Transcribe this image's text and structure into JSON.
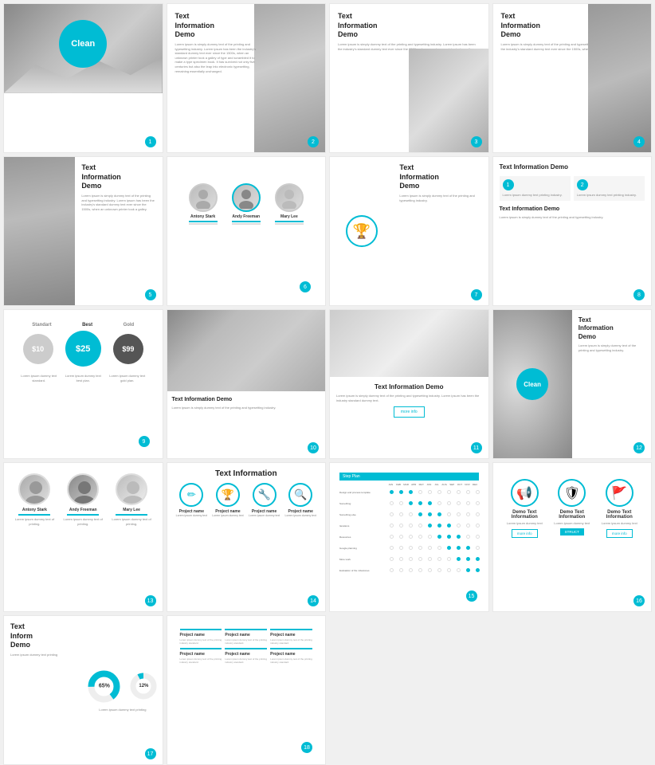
{
  "slides": [
    {
      "id": 1,
      "type": "clean-hero",
      "badge": "Clean",
      "step": "1"
    },
    {
      "id": 2,
      "type": "text-image-right",
      "title": "Text\nInformation\nDemo",
      "body": "Lorem ipsum is simply dummy text of the printing and typesetting industry. Lorem ipsum has been the industry's standard dummy text ever since the 1500s, when an unknown printer took a galley of type and scrambled it to make a type specimen book. It has survived not only five centuries but also the leap into electronic typesetting, remaining essentially unchanged.",
      "step": "2"
    },
    {
      "id": 3,
      "type": "text-image-right",
      "title": "Text\nInformation\nDemo",
      "body": "Lorem ipsum is simply dummy text of the printing and typesetting industry. Lorem ipsum has been the industry's standard dummy text ever since the 1500s, when an unknown printer took a galley.",
      "step": "3"
    },
    {
      "id": 4,
      "type": "team",
      "members": [
        {
          "name": "Antony Stark"
        },
        {
          "name": "Andy Freeman"
        },
        {
          "name": "Mary Lee"
        }
      ],
      "step": "4"
    },
    {
      "id": 5,
      "type": "trophy-text",
      "title": "Text\nInformation\nDemo",
      "body": "Lorem ipsum is simply dummy text of the printing and typesetting industry.",
      "step": "5"
    },
    {
      "id": 6,
      "type": "text-image-split",
      "title": "Text Information Demo",
      "body": "Lorem ipsum is simply dummy text of the printing and typesetting industry. Lorem ipsum has been the industry standard.",
      "step": "6"
    },
    {
      "id": 7,
      "type": "text-image-split2",
      "title": "Text Information Demo",
      "subtitle": "Text Information Demo",
      "body": "Lorem ipsum is simply dummy text of the printing and typesetting industry.",
      "step": "7"
    },
    {
      "id": 8,
      "type": "pricing",
      "plans": [
        {
          "name": "Standart",
          "price": "$10",
          "style": "standard"
        },
        {
          "name": "Best",
          "price": "$25",
          "style": "best"
        },
        {
          "name": "Gold",
          "price": "$99",
          "style": "gold"
        }
      ],
      "step": "8"
    },
    {
      "id": 9,
      "type": "wave-text",
      "title": "Text Information Demo",
      "body": "Lorem ipsum is simply dummy text of the printing and typesetting industry.",
      "step": "9"
    },
    {
      "id": 10,
      "type": "center-text",
      "title": "Text Information Demo",
      "body": "Lorem ipsum is simply dummy text of the printing and typesetting industry. Lorem ipsum has been the industry standard dummy text.",
      "btn": "more info",
      "step": "10"
    },
    {
      "id": 11,
      "type": "circle-clean-scenic",
      "title": "Text\nInformation\nDemo",
      "badge": "Clean",
      "body": "Lorem ipsum is simply dummy text of the printing and typesetting industry.",
      "step": "11"
    },
    {
      "id": 12,
      "type": "team2",
      "title": "Text Information",
      "members": [
        {
          "name": "Antony Stark"
        },
        {
          "name": "Andy Freeman"
        },
        {
          "name": "Mary Lee"
        }
      ],
      "step": "12"
    },
    {
      "id": 13,
      "type": "icons-4",
      "title": "Text Information",
      "items": [
        {
          "label": "Project name",
          "desc": "Lorem ipsum dummy text"
        },
        {
          "label": "Project name",
          "desc": "Lorem ipsum dummy text"
        },
        {
          "label": "Project name",
          "desc": "Lorem ipsum dummy text"
        },
        {
          "label": "Project name",
          "desc": "Lorem ipsum dummy text"
        }
      ],
      "step": "13"
    },
    {
      "id": 14,
      "type": "gantt",
      "title": "Step Plan",
      "months": [
        "JAN",
        "FEB",
        "MAR",
        "APR",
        "MAY",
        "JUN",
        "JUL",
        "AUG",
        "SEP",
        "OCT",
        "NOV",
        "DEC"
      ],
      "rows": [
        {
          "label": "Design and process template",
          "dots": [
            1,
            1,
            1,
            0,
            0,
            0,
            0,
            0,
            0,
            0,
            0,
            0
          ]
        },
        {
          "label": "Something",
          "dots": [
            0,
            0,
            1,
            1,
            1,
            0,
            0,
            0,
            0,
            0,
            0,
            0
          ]
        },
        {
          "label": "Something else",
          "dots": [
            0,
            0,
            0,
            1,
            1,
            1,
            0,
            0,
            0,
            0,
            0,
            0
          ]
        },
        {
          "label": "Iterations",
          "dots": [
            0,
            0,
            0,
            0,
            1,
            1,
            1,
            0,
            0,
            0,
            0,
            0
          ]
        },
        {
          "label": "Resources",
          "dots": [
            0,
            0,
            0,
            0,
            0,
            1,
            1,
            1,
            0,
            0,
            0,
            0
          ]
        },
        {
          "label": "Google planning",
          "dots": [
            0,
            0,
            0,
            0,
            0,
            0,
            1,
            1,
            1,
            0,
            0,
            0
          ]
        },
        {
          "label": "More work",
          "dots": [
            0,
            0,
            0,
            0,
            0,
            0,
            0,
            1,
            1,
            1,
            0,
            0
          ]
        },
        {
          "label": "Evaluation of the milestones",
          "dots": [
            0,
            0,
            0,
            0,
            0,
            0,
            0,
            0,
            1,
            1,
            1,
            0
          ]
        }
      ],
      "step": "14"
    },
    {
      "id": 15,
      "type": "icon-boxes",
      "items": [
        {
          "icon": "📢",
          "title": "Demo Text Information",
          "desc": "Lorem ipsum dummy text",
          "btn": "more info"
        },
        {
          "icon": "🛡",
          "title": "Demo Text Information",
          "desc": "Lorem ipsum dummy text",
          "btn": "STRUCT"
        },
        {
          "icon": "🚩",
          "title": "Demo Text Information",
          "desc": "Lorem ipsum dummy text",
          "btn": "more info"
        }
      ],
      "step": "15"
    },
    {
      "id": 16,
      "type": "pie-text",
      "title": "Text Inform Demo",
      "percent1": "65%",
      "percent2": "12%",
      "body": "Lorem ipsum dummy text printing",
      "step": "16"
    },
    {
      "id": 17,
      "type": "project-names",
      "items": [
        {
          "name": "Project name",
          "desc": "Lorem ipsum dummy text"
        },
        {
          "name": "Project name",
          "desc": "Lorem ipsum dummy text"
        },
        {
          "name": "Project name",
          "desc": "Lorem ipsum dummy text"
        },
        {
          "name": "Project name",
          "desc": "Lorem ipsum dummy text"
        },
        {
          "name": "Project name",
          "desc": "Lorem ipsum dummy text"
        },
        {
          "name": "Project name",
          "desc": "Lorem ipsum dummy text"
        }
      ],
      "step": "17"
    }
  ],
  "colors": {
    "accent": "#00bcd4",
    "text_dark": "#222222",
    "text_medium": "#555555",
    "text_light": "#888888"
  }
}
